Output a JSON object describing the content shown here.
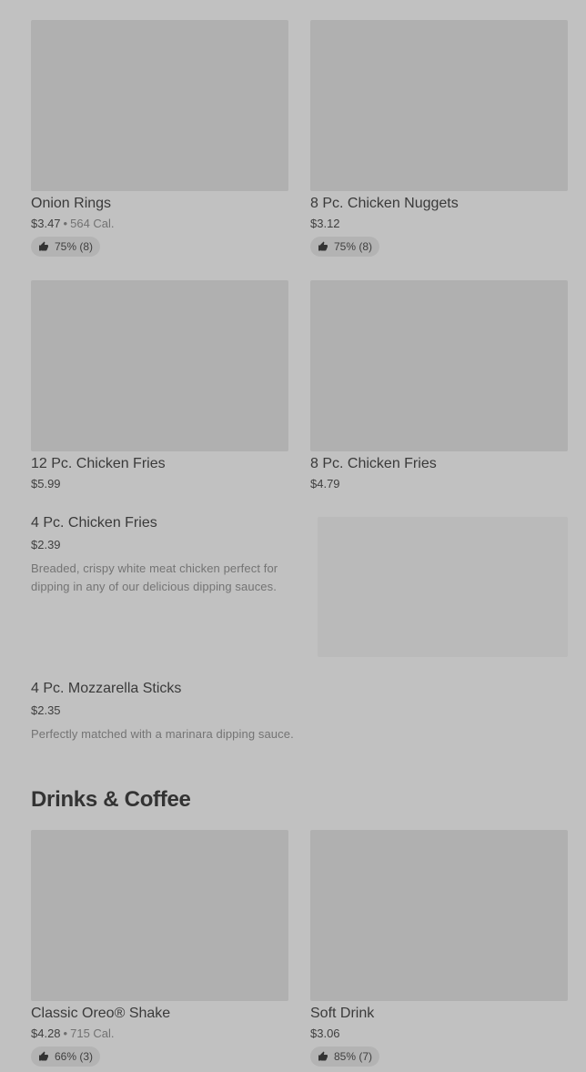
{
  "sides_grid": [
    {
      "name": "Onion Rings",
      "price": "$3.47",
      "calories": "564 Cal.",
      "rating": "75% (8)"
    },
    {
      "name": "8 Pc. Chicken Nuggets",
      "price": "$3.12",
      "calories": "",
      "rating": "75% (8)"
    },
    {
      "name": "12 Pc. Chicken Fries",
      "price": "$5.99",
      "calories": "",
      "rating": ""
    },
    {
      "name": "8 Pc. Chicken Fries",
      "price": "$4.79",
      "calories": "",
      "rating": ""
    }
  ],
  "list_items": [
    {
      "name": "4 Pc. Chicken Fries",
      "price": "$2.39",
      "description": "Breaded, crispy white meat chicken perfect for dipping in any of our delicious dipping sauces."
    },
    {
      "name": "4 Pc. Mozzarella Sticks",
      "price": "$2.35",
      "description": "Perfectly matched with a marinara dipping sauce."
    }
  ],
  "drinks_section": {
    "title": "Drinks & Coffee",
    "items": [
      {
        "name": "Classic Oreo® Shake",
        "price": "$4.28",
        "calories": "715 Cal.",
        "rating": "66% (3)"
      },
      {
        "name": "Soft Drink",
        "price": "$3.06",
        "calories": "",
        "rating": "85% (7)"
      }
    ]
  },
  "icons": {
    "rating": "thumbs-up-icon"
  },
  "colors": {
    "background": "#c1c1c1",
    "placeholder": "#b0b0b0",
    "text": "#3a3a3a"
  }
}
